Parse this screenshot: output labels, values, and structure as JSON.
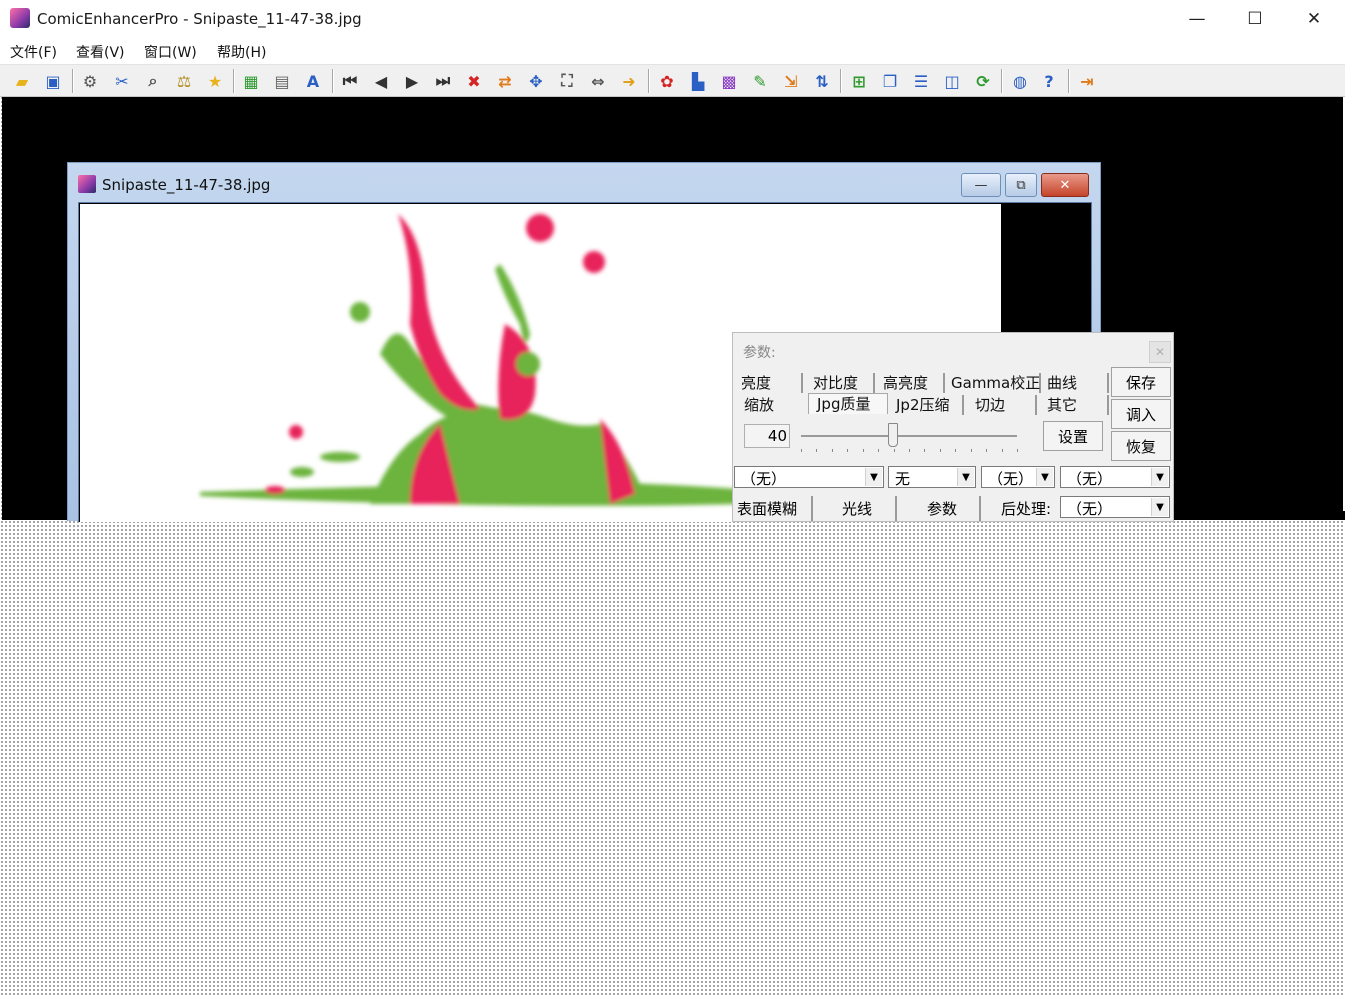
{
  "window": {
    "title": "ComicEnhancerPro - Snipaste_11-47-38.jpg",
    "minimize_glyph": "—",
    "maximize_glyph": "☐",
    "close_glyph": "✕"
  },
  "menu": [
    "文件(F)",
    "查看(V)",
    "窗口(W)",
    "帮助(H)"
  ],
  "toolbar": {
    "icons": [
      "open-folder-icon",
      "save-icon",
      "batch-icon",
      "cut-icon",
      "find-icon",
      "compare-icon",
      "favorite-star-icon",
      "grid-icon",
      "pages-icon",
      "spellcheck-icon",
      "first-page-icon",
      "prev-page-icon",
      "next-page-icon",
      "last-page-icon",
      "delete-icon",
      "swap-icon",
      "fit-icon",
      "fit-screen-icon",
      "fit-width-icon",
      "export-icon",
      "color-wheel-icon",
      "histogram-icon",
      "palette-icon",
      "brush-icon",
      "import-icon",
      "sort-icon",
      "add-page-icon",
      "layers-icon",
      "split-horizontal-icon",
      "split-vertical-icon",
      "refresh-icon",
      "globe-icon",
      "help-book-icon",
      "exit-icon"
    ],
    "accents": {
      "yellow": "#e8b21a",
      "blue": "#2a5fc4",
      "red": "#d42424",
      "green": "#2e9a2e",
      "orange": "#e07a18",
      "purple": "#8a3ac4"
    }
  },
  "child_window": {
    "title": "Snipaste_11-47-38.jpg",
    "minimize_glyph": "—",
    "restore_glyph": "⧉",
    "close_glyph": "✕"
  },
  "image": {
    "description_colors": {
      "pink": "#e8205a",
      "green": "#6cb43c"
    }
  },
  "panel": {
    "label": "参数:",
    "close_glyph": "✕",
    "tabs_row1": [
      "亮度",
      "对比度",
      "高亮度",
      "Gamma校正",
      "曲线"
    ],
    "tabs_row2": [
      "缩放",
      "Jpg质量",
      "Jp2压缩",
      "切边",
      "其它"
    ],
    "active_tab": "Jpg质量",
    "side_buttons": [
      "保存",
      "调入",
      "恢复"
    ],
    "value": "40",
    "slider_fraction": 0.42,
    "set_button": "设置",
    "combos": [
      "（无）",
      "无",
      "（无）",
      "（无）"
    ],
    "bottom_tabs": [
      "表面模糊",
      "光线",
      "参数"
    ],
    "post_label": "后处理:",
    "post_value": "（无）",
    "dropdown_glyph": "▼"
  }
}
